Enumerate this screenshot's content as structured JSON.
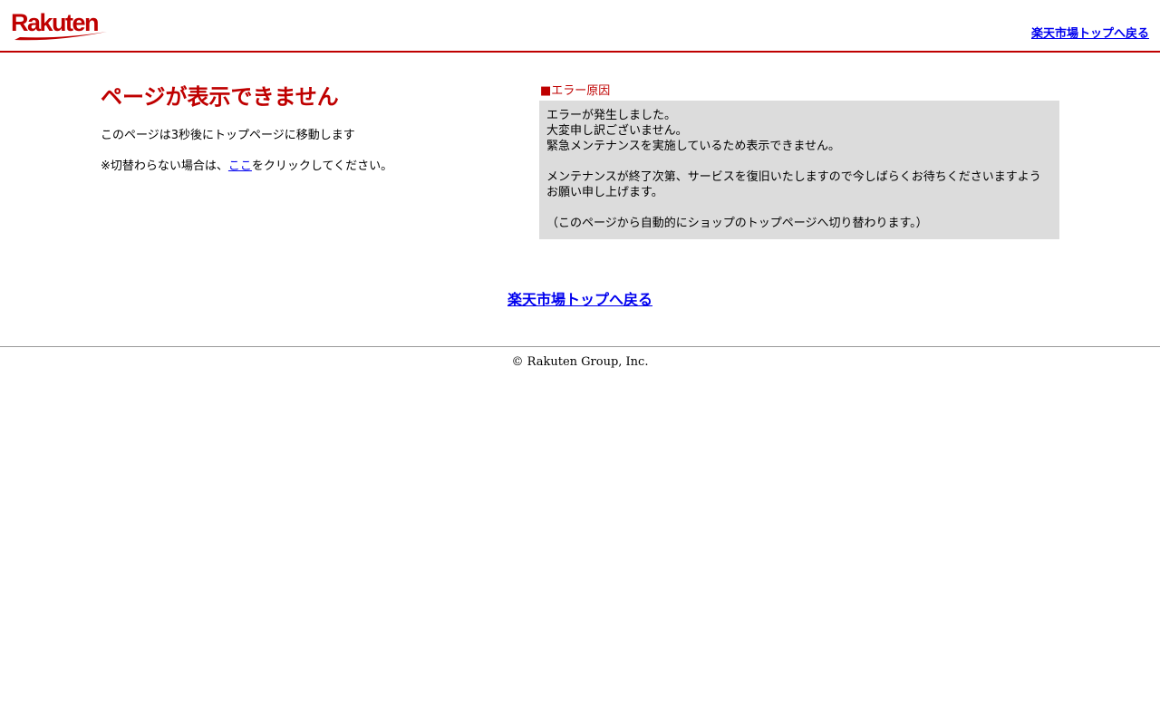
{
  "header": {
    "logo_text": "Rakuten",
    "top_link": "楽天市場トップへ戻る"
  },
  "main": {
    "title": "ページが表示できません",
    "redirect_message": "このページは3秒後にトップページに移動します",
    "click_prefix": "※切替わらない場合は、",
    "click_link": "ここ",
    "click_suffix": "をクリックしてください。"
  },
  "error": {
    "heading": "■エラー原因",
    "lines": [
      "エラーが発生しました。",
      "大変申し訳ございません。",
      "緊急メンテナンスを実施しているため表示できません。"
    ],
    "maintenance": "メンテナンスが終了次第、サービスを復旧いたしますので今しばらくお待ちくださいますようお願い申し上げます。",
    "auto_switch": "（このページから自動的にショップのトップページへ切り替わります。）"
  },
  "bottom_link": "楽天市場トップへ戻る",
  "footer": {
    "copyright": "© Rakuten Group, Inc."
  },
  "colors": {
    "brand": "#bf0000",
    "link": "#0000ee",
    "box_bg": "#dcdcdc"
  }
}
